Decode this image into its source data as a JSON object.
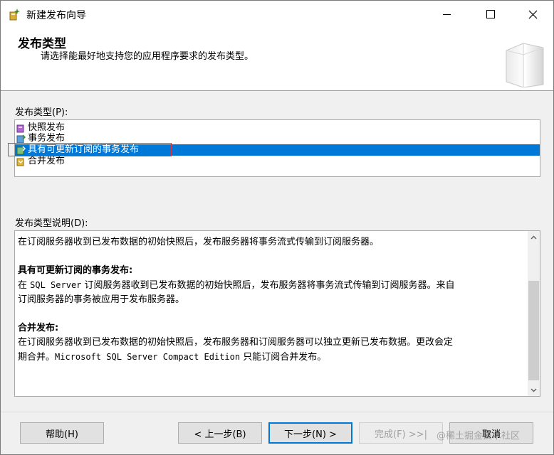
{
  "window": {
    "title": "新建发布向导"
  },
  "header": {
    "title": "发布类型",
    "subtitle": "请选择能最好地支持您的应用程序要求的发布类型。"
  },
  "publication_type": {
    "label": "发布类型(P):",
    "items": [
      {
        "label": "快照发布",
        "icon": "snapshot-publication-icon",
        "selected": false
      },
      {
        "label": "事务发布",
        "icon": "transactional-publication-icon",
        "selected": false
      },
      {
        "label": "具有可更新订阅的事务发布",
        "icon": "updatable-transactional-publication-icon",
        "selected": true
      },
      {
        "label": "合并发布",
        "icon": "merge-publication-icon",
        "selected": false
      }
    ],
    "selected_color": "#0078d7",
    "highlight_outline_color": "#e0303a"
  },
  "description": {
    "label": "发布类型说明(D):",
    "line1": "在订阅服务器收到已发布数据的初始快照后，发布服务器将事务流式传输到订阅服务器。",
    "section2_title": "具有可更新订阅的事务发布:",
    "section2_line1_a": "在 ",
    "section2_line1_mono": "SQL Server",
    "section2_line1_b": " 订阅服务器收到已发布数据的初始快照后，发布服务器将事务流式传输到订阅服务器。来自",
    "section2_line2": "订阅服务器的事务被应用于发布服务器。",
    "section3_title": "合并发布:",
    "section3_line1": "在订阅服务器收到已发布数据的初始快照后，发布服务器和订阅服务器可以独立更新已发布数据。更改会定",
    "section3_line2_a": "期合并。",
    "section3_line2_mono": "Microsoft SQL Server Compact Edition",
    "section3_line2_b": " 只能订阅合并发布。"
  },
  "buttons": {
    "help": "帮助(H)",
    "back": "< 上一步(B)",
    "next": "下一步(N) >",
    "finish": "完成(F) >>|",
    "cancel": "取消"
  },
  "watermark": "@稀土掘金技术社区"
}
